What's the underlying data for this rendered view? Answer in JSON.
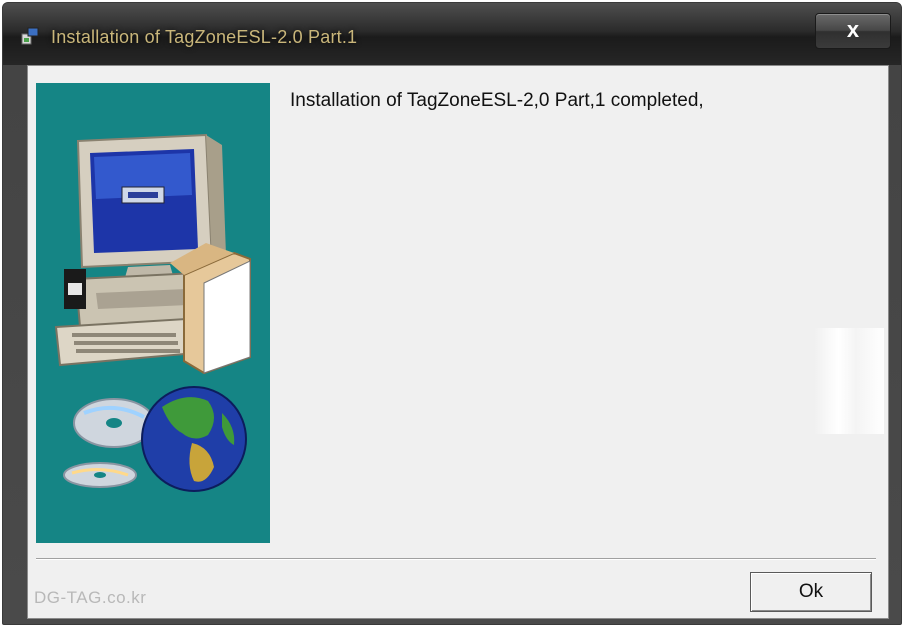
{
  "window": {
    "title": "Installation of TagZoneESL-2.0 Part.1",
    "close_glyph": "x",
    "icon": "installer-icon"
  },
  "content": {
    "message": "Installation of TagZoneESL-2,0 Part,1 completed,",
    "illustration": "computer-cd-globe-illustration"
  },
  "footer": {
    "brand": "DG-TAG.co.kr",
    "ok_label": "Ok"
  },
  "colors": {
    "side_panel": "#158585",
    "dialog_bg": "#f0f0f0",
    "titlebar": "#2b2b2b",
    "title_text": "#c9b67a"
  }
}
